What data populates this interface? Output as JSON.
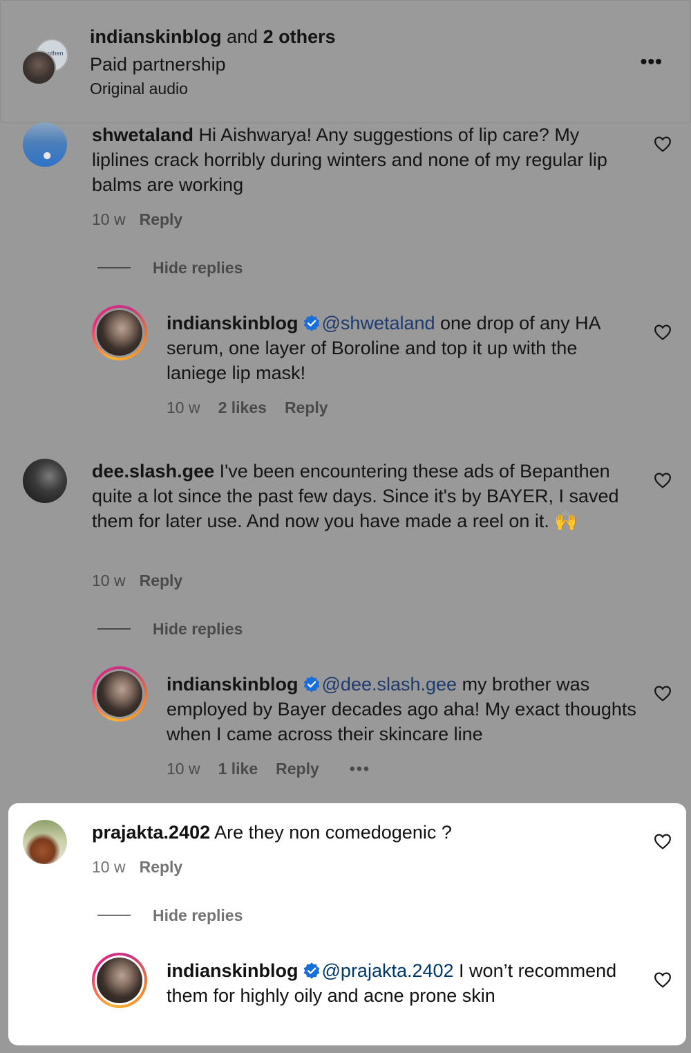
{
  "header": {
    "account": "indianskinblog",
    "and_label": " and ",
    "others": "2 others",
    "subtitle": "Paid partnership",
    "audio": "Original audio",
    "avatar_back_text": "nthen",
    "more_label": "•••"
  },
  "comments": [
    {
      "user": "shwetaland",
      "text": " Hi Aishwarya! Any suggestions of lip care? My liplines crack horribly during winters and none of my regular lip balms are working",
      "time": "10 w",
      "reply": "Reply",
      "hide_replies": "Hide replies",
      "replies": [
        {
          "user": "indianskinblog",
          "mention": "@shwetaland",
          "text": " one drop of any HA serum, one layer of Boroline and top it up with the laniege lip mask!",
          "time": "10 w",
          "likes": "2 likes",
          "reply": "Reply"
        }
      ]
    },
    {
      "user": "dee.slash.gee",
      "text": " I've been encountering these ads of Bepanthen quite a lot since the past few days. Since it's by BAYER, I saved them for later use. And now you have made a reel on it. 🙌",
      "time": "10 w",
      "reply": "Reply",
      "hide_replies": "Hide replies",
      "replies": [
        {
          "user": "indianskinblog",
          "mention": "@dee.slash.gee",
          "text": " my brother was employed by Bayer decades ago aha! My exact thoughts when I came across their skincare line",
          "time": "10 w",
          "likes": "1 like",
          "reply": "Reply",
          "more": "•••"
        }
      ]
    },
    {
      "user": "prajakta.2402",
      "text": " Are they non comedogenic ?",
      "time": "10 w",
      "reply": "Reply",
      "hide_replies": "Hide replies",
      "replies": [
        {
          "user": "indianskinblog",
          "mention": "@prajakta.2402",
          "text": " I won’t recommend them for highly oily and acne prone skin"
        }
      ]
    }
  ],
  "colors": {
    "overlay_gray": "#999999",
    "mention_blue": "#1e3a6e",
    "verified_blue": "#1a6ed8",
    "panel_white": "#ffffff"
  },
  "icons": [
    "heart-icon",
    "verified-badge-icon",
    "more-icon"
  ]
}
